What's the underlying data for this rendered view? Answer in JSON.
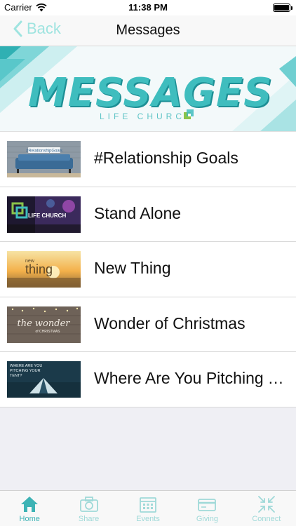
{
  "status": {
    "carrier": "Carrier",
    "time": "11:38 PM"
  },
  "nav": {
    "back_label": "Back",
    "title": "Messages"
  },
  "banner": {
    "title": "MESSAGES",
    "subtitle": "LIFE CHURCH"
  },
  "messages": [
    {
      "title": "#Relationship Goals",
      "thumb_text": "#RelationshipGoals"
    },
    {
      "title": "Stand Alone",
      "thumb_text": "LIFE CHURCH"
    },
    {
      "title": "New Thing",
      "thumb_text_small": "new",
      "thumb_text": "thing"
    },
    {
      "title": "Wonder of Christmas",
      "thumb_text": "the wonder",
      "thumb_text_small": "of CHRISTMAS"
    },
    {
      "title": "Where Are You Pitching Your Tent?",
      "thumb_text": "WHERE ARE YOU PITCHING YOUR TENT?"
    }
  ],
  "tabs": [
    {
      "label": "Home",
      "icon": "home-icon",
      "active": true
    },
    {
      "label": "Share",
      "icon": "camera-icon",
      "active": false
    },
    {
      "label": "Events",
      "icon": "calendar-icon",
      "active": false
    },
    {
      "label": "Giving",
      "icon": "card-icon",
      "active": false
    },
    {
      "label": "Connect",
      "icon": "connect-icon",
      "active": false
    }
  ],
  "colors": {
    "accent": "#3db3b5",
    "accent_light": "#9fe4e0"
  }
}
